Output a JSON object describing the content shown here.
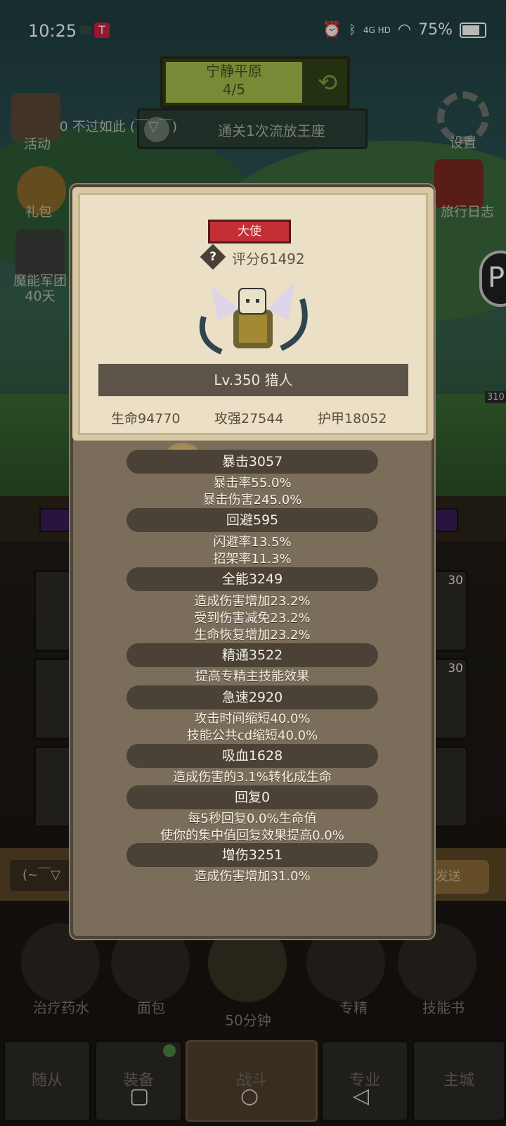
{
  "status_bar": {
    "time": "10:25",
    "network": "4G HD",
    "battery": "75%"
  },
  "hud": {
    "zone_name": "宁静平原",
    "zone_progress": "4/5",
    "quest_text": "通关1次流放王座",
    "player_line": "Lv.350 不过如此 (￣▽￣)",
    "settings_label": "设置",
    "activity_label": "活动",
    "gift_label": "礼包",
    "legion_label": "魔能军团",
    "legion_sub": "40天",
    "travel_log_label": "旅行日志",
    "enemy_level": "310"
  },
  "popup": {
    "title_badge": "大使",
    "score": "评分61492",
    "name": "Lv.350 猎人",
    "main_stats": {
      "hp": "生命94770",
      "attack": "攻强27544",
      "armor": "护甲18052"
    },
    "stat_groups": [
      {
        "header": "暴击3057",
        "lines": [
          "暴击率55.0%",
          "暴击伤害245.0%"
        ]
      },
      {
        "header": "回避595",
        "lines": [
          "闪避率13.5%",
          "招架率11.3%"
        ]
      },
      {
        "header": "全能3249",
        "lines": [
          "造成伤害增加23.2%",
          "受到伤害减免23.2%",
          "生命恢复增加23.2%"
        ]
      },
      {
        "header": "精通3522",
        "lines": [
          "提高专精主技能效果"
        ]
      },
      {
        "header": "急速2920",
        "lines": [
          "攻击时间缩短40.0%",
          "技能公共cd缩短40.0%"
        ]
      },
      {
        "header": "吸血1628",
        "lines": [
          "造成伤害的3.1%转化成生命"
        ]
      },
      {
        "header": "回复0",
        "lines": [
          "每5秒回复0.0%生命值",
          "使你的集中值回复效果提高0.0%"
        ]
      },
      {
        "header": "增伤3251",
        "lines": [
          "造成伤害增加31.0%"
        ]
      }
    ]
  },
  "equipment_levels": [
    "30",
    "30"
  ],
  "chat": {
    "text": "(~￣▽",
    "send": "发送"
  },
  "actions": [
    {
      "label": "治疗药水",
      "icon": "potion-icon"
    },
    {
      "label": "面包",
      "icon": "bread-icon"
    },
    {
      "label": "50分钟",
      "icon": "chest-icon"
    },
    {
      "label": "专精",
      "icon": "spec-icon"
    },
    {
      "label": "技能书",
      "icon": "book-icon"
    }
  ],
  "nav": [
    "随从",
    "装备",
    "战斗",
    "专业",
    "主城"
  ],
  "colors": {
    "badge_red": "#c42e35",
    "card_bg": "#ebe0c6",
    "stat_header_bg": "#4a4237",
    "panel_bg": "#7a6d5a"
  }
}
